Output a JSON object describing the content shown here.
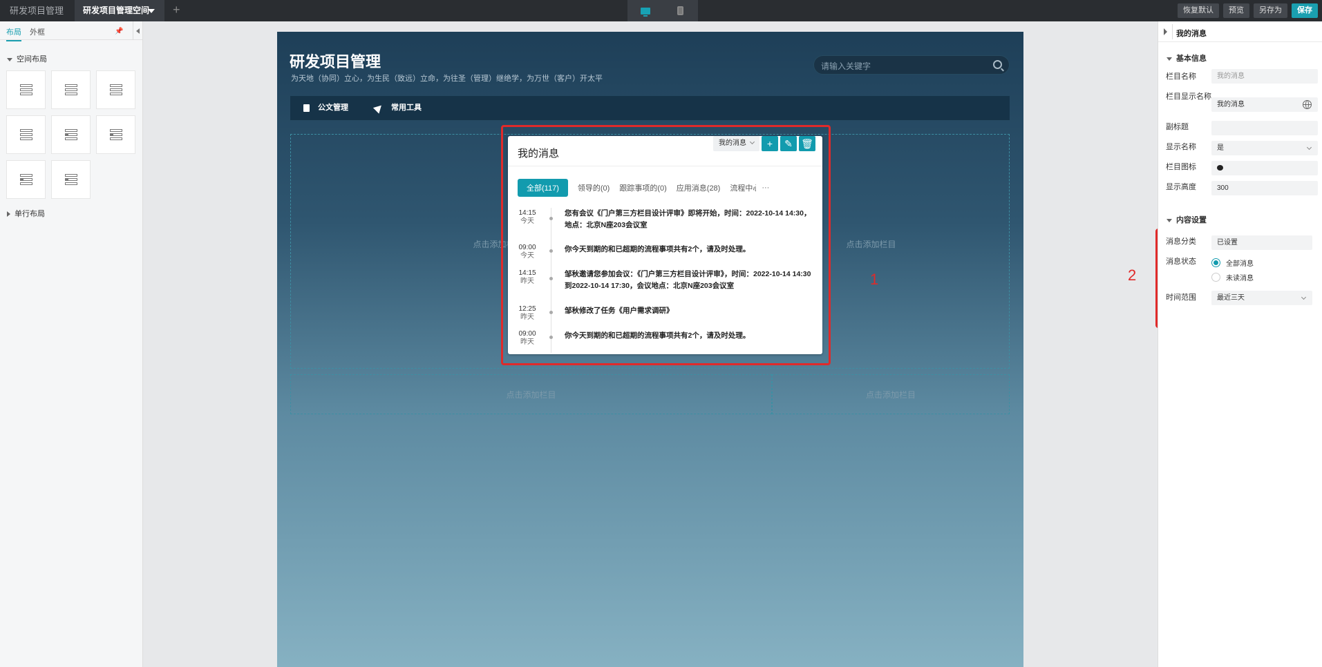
{
  "topbar": {
    "tabs": [
      "研发项目管理",
      "研发项目管理空间"
    ],
    "add_label": "+",
    "buttons": [
      "恢复默认",
      "预览",
      "另存为",
      "保存"
    ]
  },
  "left": {
    "tabs": [
      "布局",
      "外框"
    ],
    "sections": [
      "空间布局",
      "单行布局"
    ]
  },
  "canvas": {
    "title": "研发项目管理",
    "subtitle": "为天地（协同）立心，为生民（致远）立命，为往圣（管理）继绝学，为万世（客户）开太平",
    "search_placeholder": "请输入关键字",
    "nav": [
      "公文管理",
      "常用工具"
    ],
    "dropzone_label": "点击添加栏目"
  },
  "widget": {
    "title": "我的消息",
    "toolbar_select": "我的消息",
    "tabs": [
      "全部(117)",
      "领导的(0)",
      "跟踪事项的(0)",
      "应用消息(28)",
      "流程中心"
    ],
    "more": "···",
    "items": [
      {
        "time": "14:15",
        "day": "今天",
        "text": "您有会议《门户第三方栏目设计评审》即将开始，时间：2022-10-14 14:30，地点：北京N座203会议室"
      },
      {
        "time": "09:00",
        "day": "今天",
        "text": "你今天到期的和已超期的流程事项共有2个，请及时处理。"
      },
      {
        "time": "14:15",
        "day": "昨天",
        "text": "邹秋邀请您参加会议：《门户第三方栏目设计评审》，时间：2022-10-14 14:30到2022-10-14 17:30，会议地点：北京N座203会议室"
      },
      {
        "time": "12:25",
        "day": "昨天",
        "text": "邹秋修改了任务《用户需求调研》"
      },
      {
        "time": "09:00",
        "day": "昨天",
        "text": "你今天到期的和已超期的流程事项共有2个，请及时处理。"
      }
    ]
  },
  "annotations": [
    "1",
    "2"
  ],
  "right": {
    "header": "我的消息",
    "basic_title": "基本信息",
    "fields": [
      {
        "label": "栏目名称",
        "value": "我的消息"
      },
      {
        "label": "栏目显示名称",
        "value": "我的消息"
      },
      {
        "label": "副标题",
        "value": ""
      },
      {
        "label": "显示名称",
        "value": "是"
      },
      {
        "label": "栏目图标",
        "value": ""
      },
      {
        "label": "显示高度",
        "value": "300"
      }
    ],
    "content_title": "内容设置",
    "msg_category": {
      "label": "消息分类",
      "value": "已设置"
    },
    "msg_status": {
      "label": "消息状态",
      "options": [
        "全部消息",
        "未读消息"
      ],
      "selected": "全部消息"
    },
    "time_range": {
      "label": "时间范围",
      "value": "最近三天"
    }
  },
  "colors": {
    "accent": "#129bae",
    "highlight": "#e02a2a"
  }
}
